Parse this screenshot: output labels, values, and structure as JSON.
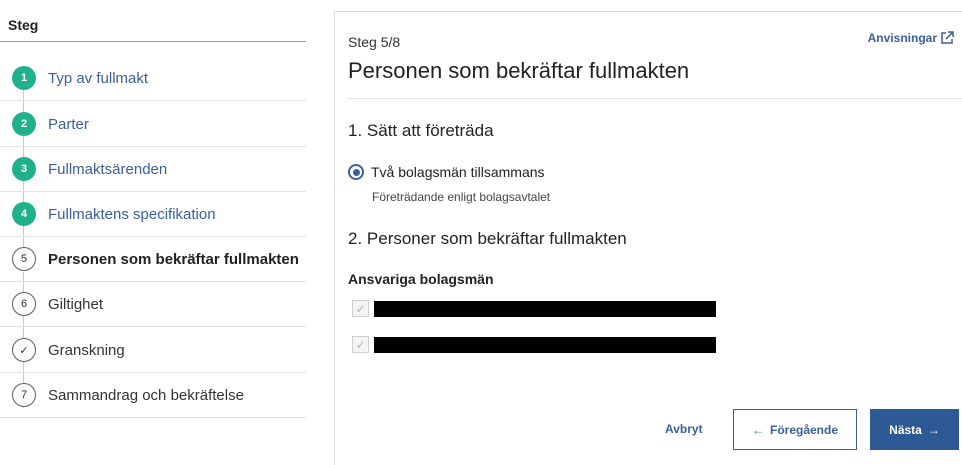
{
  "sidebar": {
    "header": "Steg",
    "steps": [
      {
        "marker": "1",
        "label": "Typ av fullmakt",
        "status": "done"
      },
      {
        "marker": "2",
        "label": "Parter",
        "status": "done"
      },
      {
        "marker": "3",
        "label": "Fullmaktsärenden",
        "status": "done"
      },
      {
        "marker": "4",
        "label": "Fullmaktens specifikation",
        "status": "done"
      },
      {
        "marker": "5",
        "label": "Personen som bekräftar fullmakten",
        "status": "current"
      },
      {
        "marker": "6",
        "label": "Giltighet",
        "status": "todo"
      },
      {
        "marker": "✓",
        "label": "Granskning",
        "status": "todo"
      },
      {
        "marker": "7",
        "label": "Sammandrag och bekräftelse",
        "status": "todo"
      }
    ]
  },
  "main": {
    "step_count": "Steg 5/8",
    "guide_link": "Anvisningar",
    "title": "Personen som bekräftar fullmakten",
    "section1_title": "1. Sätt att företräda",
    "radio_label": "Två bolagsmän tillsammans",
    "radio_sub": "Företrädande enligt bolagsavtalet",
    "section2_title": "2. Personer som bekräftar fullmakten",
    "group_label": "Ansvariga bolagsmän"
  },
  "footer": {
    "cancel": "Avbryt",
    "previous": "Föregående",
    "next": "Nästa"
  },
  "colors": {
    "done": "#1fb08c",
    "link": "#3a5f9a",
    "primary": "#2d5a94"
  }
}
